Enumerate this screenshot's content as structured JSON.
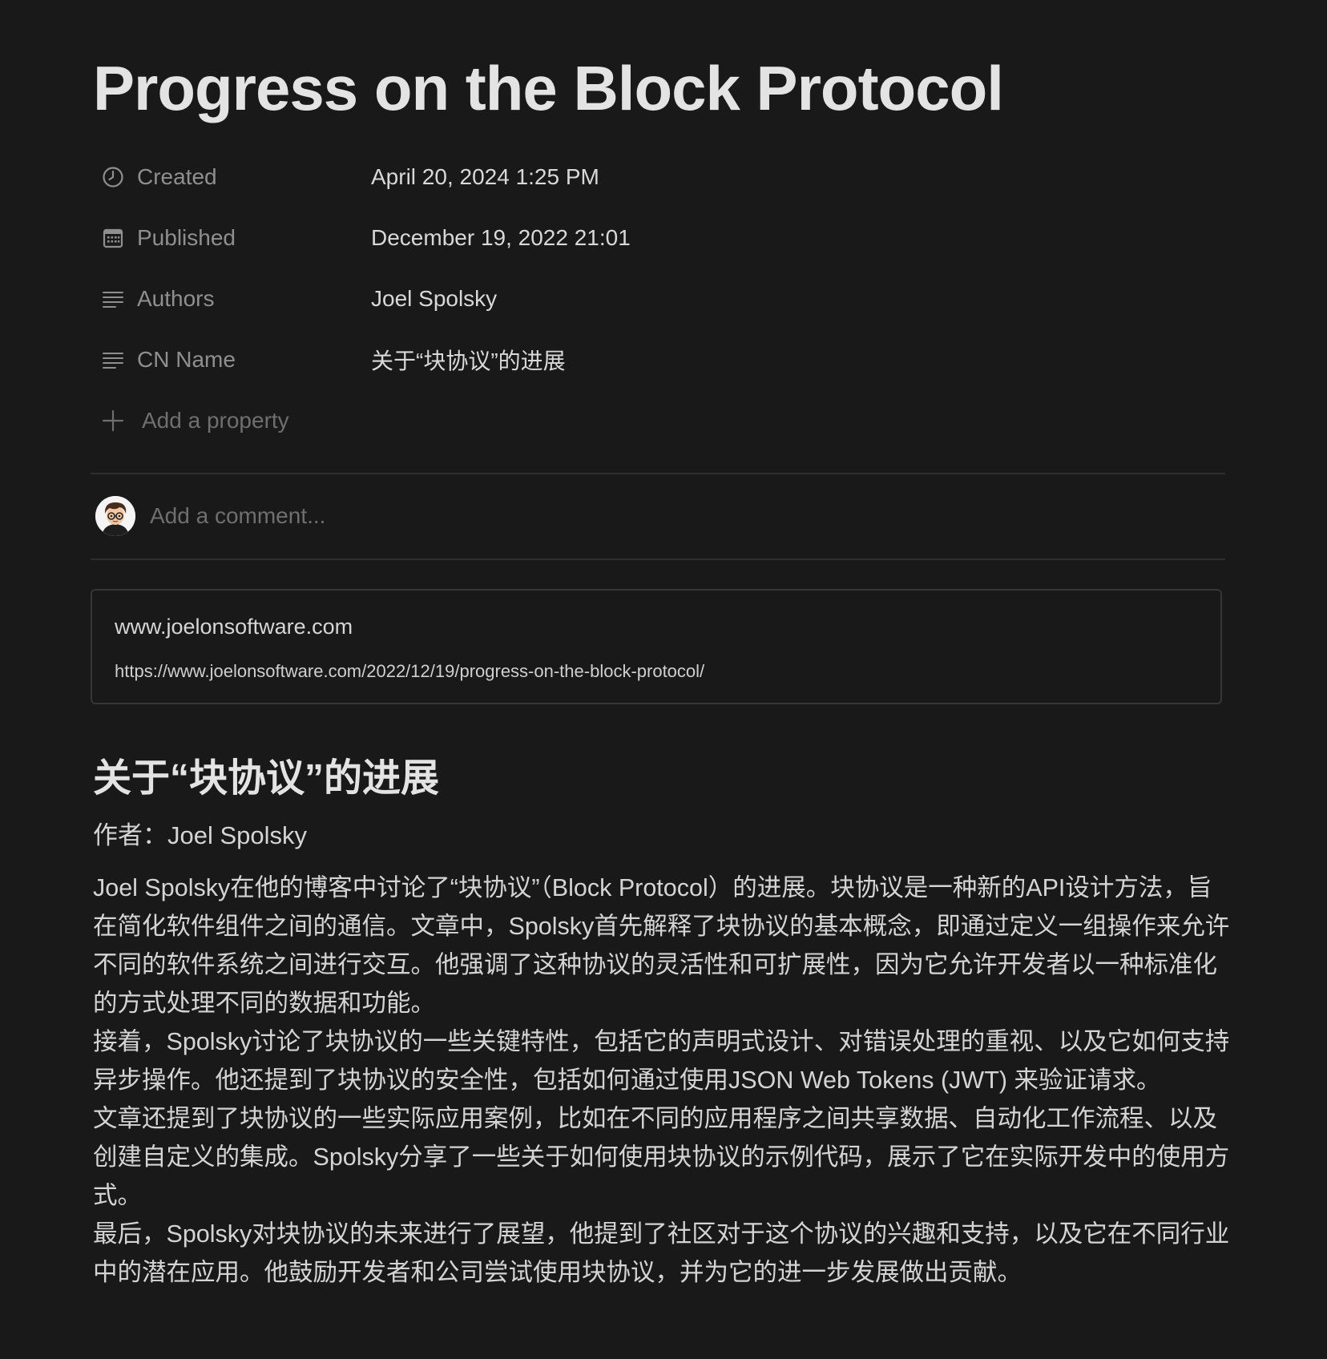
{
  "page": {
    "title": "Progress on the Block Protocol"
  },
  "properties": [
    {
      "icon": "clock-icon",
      "key": "Created",
      "value": "April 20, 2024 1:25 PM"
    },
    {
      "icon": "calendar-icon",
      "key": "Published",
      "value": "December 19, 2022 21:01"
    },
    {
      "icon": "text-lines-icon",
      "key": "Authors",
      "value": "Joel Spolsky"
    },
    {
      "icon": "text-lines-icon",
      "key": "CN Name",
      "value": "关于“块协议”的进展"
    }
  ],
  "add_property_label": "Add a property",
  "comment": {
    "placeholder": "Add a comment..."
  },
  "bookmark": {
    "site": "www.joelonsoftware.com",
    "url": "https://www.joelonsoftware.com/2022/12/19/progress-on-the-block-protocol/"
  },
  "content": {
    "heading": "关于“块协议”的进展",
    "byline": "作者：Joel Spolsky",
    "paragraphs": [
      "Joel Spolsky在他的博客中讨论了“块协议”（Block Protocol）的进展。块协议是一种新的API设计方法，旨在简化软件组件之间的通信。文章中，Spolsky首先解释了块协议的基本概念，即通过定义一组操作来允许不同的软件系统之间进行交互。他强调了这种协议的灵活性和可扩展性，因为它允许开发者以一种标准化的方式处理不同的数据和功能。",
      "接着，Spolsky讨论了块协议的一些关键特性，包括它的声明式设计、对错误处理的重视、以及它如何支持异步操作。他还提到了块协议的安全性，包括如何通过使用JSON Web Tokens (JWT) 来验证请求。",
      "文章还提到了块协议的一些实际应用案例，比如在不同的应用程序之间共享数据、自动化工作流程、以及创建自定义的集成。Spolsky分享了一些关于如何使用块协议的示例代码，展示了它在实际开发中的使用方式。",
      "最后，Spolsky对块协议的未来进行了展望，他提到了社区对于这个协议的兴趣和支持，以及它在不同行业中的潜在应用。他鼓励开发者和公司尝试使用块协议，并为它的进一步发展做出贡献。"
    ]
  },
  "colors": {
    "background": "#191919",
    "text": "#d4d4d4",
    "muted": "#8f8f8f",
    "placeholder": "#6f6f6f",
    "divider": "#2f2f2f"
  }
}
